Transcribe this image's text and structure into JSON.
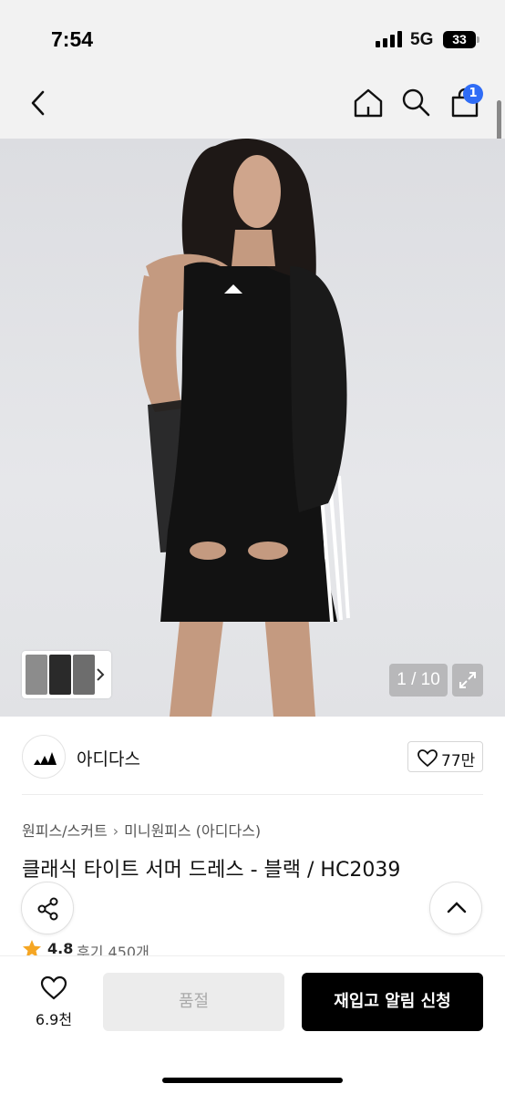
{
  "status_bar": {
    "time": "7:54",
    "network": "5G",
    "battery": "33"
  },
  "nav": {
    "cart_badge": "1"
  },
  "gallery": {
    "page_current": 1,
    "page_total": 10,
    "page_label": "1 / 10",
    "thumbnail_count": 3
  },
  "brand": {
    "name": "아디다스",
    "likes": "77만"
  },
  "product": {
    "breadcrumb": [
      "원피스/스커트",
      "미니원피스 (아디다스)"
    ],
    "title": "클래식 타이트 서머 드레스 - 블랙 / HC2039",
    "rating": "4.8",
    "review_label": "후기 450개"
  },
  "bottom_bar": {
    "wish_count": "6.9천",
    "soldout_label": "품절",
    "restock_label": "재입고 알림 신청"
  },
  "colors": {
    "accent_badge": "#2f6cf6",
    "star": "#f5a623",
    "primary_button": "#000000",
    "disabled_button": "#ececec"
  },
  "icons": [
    "back-arrow-icon",
    "home-icon",
    "search-icon",
    "shopping-bag-icon",
    "chevron-right-icon",
    "expand-icon",
    "adidas-logo-icon",
    "heart-icon",
    "share-icon",
    "chevron-up-icon",
    "star-icon"
  ]
}
